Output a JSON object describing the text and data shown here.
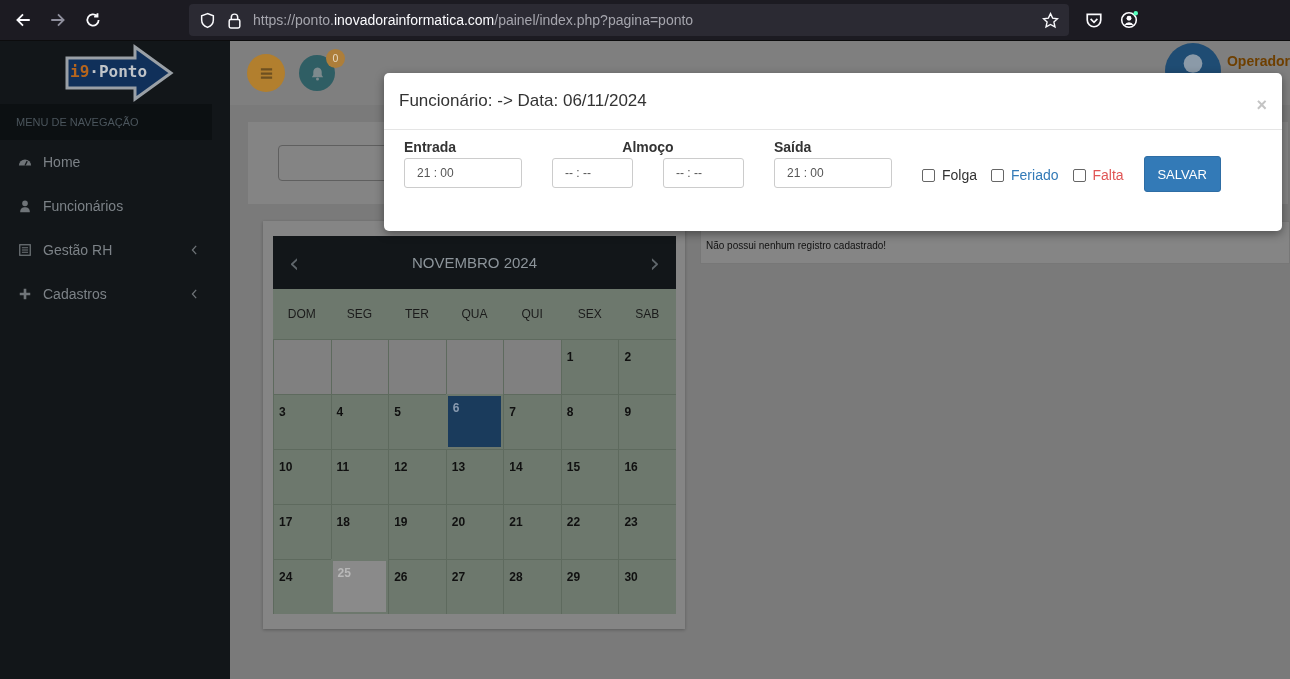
{
  "browser": {
    "url_prefix": "https://ponto.",
    "url_domain": "inovadorainformatica.com",
    "url_path": "/painel/index.php?pagina=ponto"
  },
  "sidebar": {
    "logo_main": "i9",
    "logo_rest": "·Ponto",
    "header": "MENU DE NAVEGAÇÃO",
    "items": [
      {
        "label": "Home",
        "has_submenu": false
      },
      {
        "label": "Funcionários",
        "has_submenu": false
      },
      {
        "label": "Gestão RH",
        "has_submenu": true
      },
      {
        "label": "Cadastros",
        "has_submenu": true
      }
    ]
  },
  "header": {
    "notification_count": "0",
    "user_name": "Operador"
  },
  "records": {
    "message": "Não possui nenhum registro cadastrado!"
  },
  "calendar": {
    "prev": "‹",
    "title": "NOVEMBRO 2024",
    "next": "›",
    "weekdays": [
      "DOM",
      "SEG",
      "TER",
      "QUA",
      "QUI",
      "SEX",
      "SAB"
    ],
    "days": [
      {
        "kind": "blank"
      },
      {
        "kind": "blank"
      },
      {
        "kind": "blank"
      },
      {
        "kind": "blank"
      },
      {
        "kind": "blank"
      },
      {
        "kind": "day",
        "day": "1",
        "selected": false,
        "marked": false
      },
      {
        "kind": "day",
        "day": "2",
        "selected": false,
        "marked": false
      },
      {
        "kind": "day",
        "day": "3",
        "selected": false,
        "marked": false
      },
      {
        "kind": "day",
        "day": "4",
        "selected": false,
        "marked": false
      },
      {
        "kind": "day",
        "day": "5",
        "selected": false,
        "marked": false
      },
      {
        "kind": "day",
        "day": "6",
        "selected": true,
        "marked": false
      },
      {
        "kind": "day",
        "day": "7",
        "selected": false,
        "marked": false
      },
      {
        "kind": "day",
        "day": "8",
        "selected": false,
        "marked": false
      },
      {
        "kind": "day",
        "day": "9",
        "selected": false,
        "marked": false
      },
      {
        "kind": "day",
        "day": "10",
        "selected": false,
        "marked": false
      },
      {
        "kind": "day",
        "day": "11",
        "selected": false,
        "marked": false
      },
      {
        "kind": "day",
        "day": "12",
        "selected": false,
        "marked": false
      },
      {
        "kind": "day",
        "day": "13",
        "selected": false,
        "marked": false
      },
      {
        "kind": "day",
        "day": "14",
        "selected": false,
        "marked": false
      },
      {
        "kind": "day",
        "day": "15",
        "selected": false,
        "marked": false
      },
      {
        "kind": "day",
        "day": "16",
        "selected": false,
        "marked": false
      },
      {
        "kind": "day",
        "day": "17",
        "selected": false,
        "marked": false
      },
      {
        "kind": "day",
        "day": "18",
        "selected": false,
        "marked": false
      },
      {
        "kind": "day",
        "day": "19",
        "selected": false,
        "marked": false
      },
      {
        "kind": "day",
        "day": "20",
        "selected": false,
        "marked": false
      },
      {
        "kind": "day",
        "day": "21",
        "selected": false,
        "marked": false
      },
      {
        "kind": "day",
        "day": "22",
        "selected": false,
        "marked": false
      },
      {
        "kind": "day",
        "day": "23",
        "selected": false,
        "marked": false
      },
      {
        "kind": "day",
        "day": "24",
        "selected": false,
        "marked": false
      },
      {
        "kind": "day",
        "day": "25",
        "selected": false,
        "marked": true
      },
      {
        "kind": "day",
        "day": "26",
        "selected": false,
        "marked": false
      },
      {
        "kind": "day",
        "day": "27",
        "selected": false,
        "marked": false
      },
      {
        "kind": "day",
        "day": "28",
        "selected": false,
        "marked": false
      },
      {
        "kind": "day",
        "day": "29",
        "selected": false,
        "marked": false
      },
      {
        "kind": "day",
        "day": "30",
        "selected": false,
        "marked": false
      }
    ]
  },
  "modal": {
    "title": "Funcionário: -> Data: 06/11/2024",
    "close": "×",
    "labels": {
      "entry": "Entrada",
      "lunch": "Almoço",
      "exit": "Saída"
    },
    "entry": "21 : 00",
    "lunch_start": "-- : --",
    "lunch_end": "-- : --",
    "exit": "21 : 00",
    "options": [
      {
        "label": "Folga",
        "checked": false,
        "color": "#333333"
      },
      {
        "label": "Feriado",
        "checked": false,
        "color": "#337ab7"
      },
      {
        "label": "Falta",
        "checked": false,
        "color": "#e05555"
      }
    ],
    "save": "SALVAR"
  }
}
